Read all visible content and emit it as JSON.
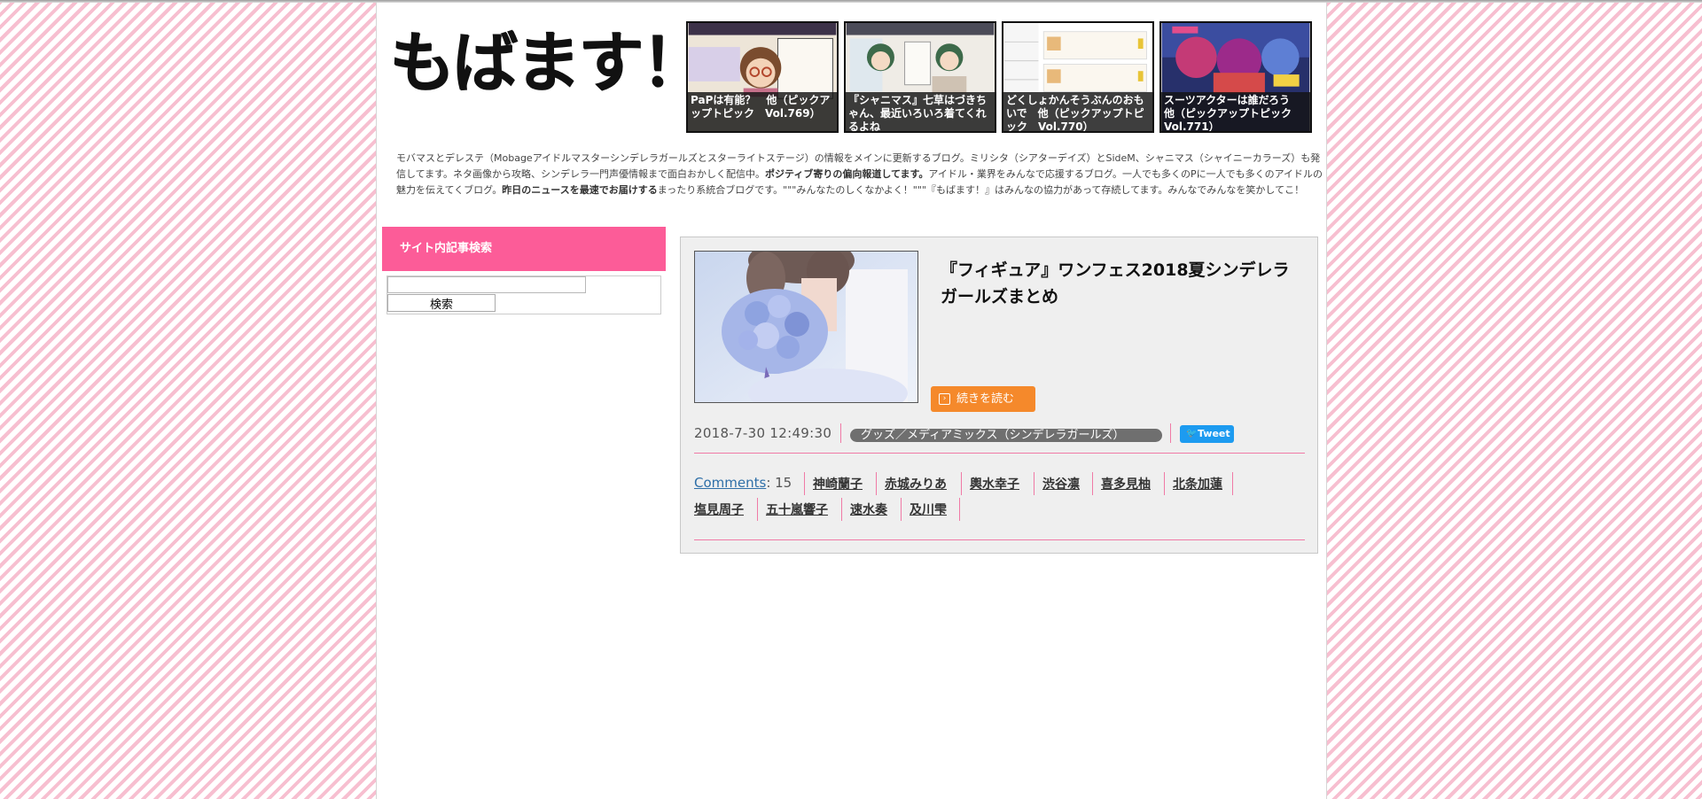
{
  "site": {
    "logo": "もばます！",
    "description": [
      {
        "text": "モバマスとデレステ（Mobageアイドルマスターシンデレラガールズとスターライトステージ）の情報をメインに更新するブログ。ミリシタ（シアターデイズ）とSideM、シャニマス（シャイニーカラーズ）も発信してます。ネタ画像から攻略、シンデレラ一門声優情報まで面白おかしく配信中。",
        "bold": false
      },
      {
        "text": "ポジティブ寄りの偏向報道してます。",
        "bold": true
      },
      {
        "text": "アイドル・業界をみんなで応援するブログ。一人でも多くのPに一人でも多くのアイドルの魅力を伝えてくブログ。",
        "bold": false
      },
      {
        "text": "昨日のニュースを最速でお届けする",
        "bold": true
      },
      {
        "text": "まったり系統合ブログです。\"\"\"みんなたのしくなかよく！\"\"\"『もばます！』はみんなの協力があって存続してます。みんなでみんなを笑かしてこ！",
        "bold": false
      }
    ]
  },
  "pickups": [
    {
      "caption": "PaPは有能？　他（ピックアップトピック　Vol.769）"
    },
    {
      "caption": "『シャニマス』七草はづきちゃん、最近いろいろ着てくれるよね"
    },
    {
      "caption": "どくしょかんそうぶんのおもいで　他（ピックアップトピック　Vol.770）"
    },
    {
      "caption": "スーツアクターは誰だろう　他（ピックアップトピック　Vol.771）"
    }
  ],
  "sidebar": {
    "search_heading": "サイト内記事検索",
    "search_value": "",
    "search_button": "検索"
  },
  "article": {
    "title": "『フィギュア』ワンフェス2018夏シンデレラガールズまとめ",
    "read_more": "続きを読む",
    "date": "2018-7-30 12:49:30",
    "category": "グッズ／メディアミックス（シンデレラガールズ）",
    "tweet": "Tweet",
    "comments_label": "Comments",
    "comments_count": ": 15",
    "tags": [
      "神崎蘭子",
      "赤城みりあ",
      "輿水幸子",
      "渋谷凛",
      "喜多見柚",
      "北条加蓮",
      "塩見周子",
      "五十嵐響子",
      "速水奏",
      "及川雫"
    ]
  },
  "colors": {
    "sidebar_heading": "#fc5c98",
    "read_more": "#f5892b",
    "tweet": "#1d9bf0",
    "divider": "#f07aa6"
  }
}
